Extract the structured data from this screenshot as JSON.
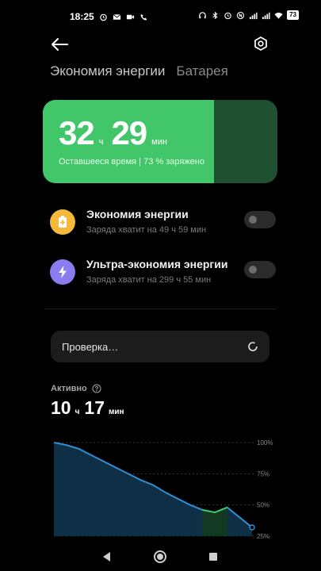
{
  "status": {
    "time": "18:25",
    "battery": "73"
  },
  "tabs": [
    {
      "label": "Экономия энергии",
      "active": true
    },
    {
      "label": "Батарея",
      "active": false
    }
  ],
  "hero": {
    "hours": "32",
    "hours_unit": "ч",
    "minutes": "29",
    "minutes_unit": "мин",
    "subtitle": "Оставшееся время | 73 % заряжено",
    "charge_fraction": 0.73
  },
  "modes": [
    {
      "title": "Экономия энергии",
      "subtitle": "Заряда хватит на 49 ч 59 мин",
      "enabled": false,
      "icon": "battery-plus-icon",
      "color": "#f4b93b"
    },
    {
      "title": "Ультра-экономия энергии",
      "subtitle": "Заряда хватит на 299 ч 55 мин",
      "enabled": false,
      "icon": "lightning-icon",
      "color": "#8c7cf2"
    }
  ],
  "scan": {
    "label": "Проверка…"
  },
  "active": {
    "label": "Активно",
    "hours": "10",
    "hours_unit": "ч",
    "minutes": "17",
    "minutes_unit": "мин"
  },
  "chart_data": {
    "type": "area",
    "y_ticks": [
      "100%",
      "75%",
      "50%",
      "25%"
    ],
    "ylim": [
      25,
      100
    ],
    "x": [
      0,
      1,
      2,
      3,
      4,
      5,
      6,
      7,
      8,
      9,
      10,
      11,
      12,
      13,
      14,
      15,
      16
    ],
    "series": [
      {
        "values": [
          100,
          98,
          95,
          90,
          85,
          80,
          75,
          70,
          66,
          60,
          55,
          50,
          46,
          44,
          48,
          40,
          32
        ]
      }
    ],
    "charging_segment": [
      12,
      14
    ]
  },
  "colors": {
    "accent": "#41c66a",
    "hero_remaining": "#1f5030",
    "chart_line": "#2f8fd4",
    "chart_fill": "#0f2f47",
    "charging": "#41c66a"
  }
}
